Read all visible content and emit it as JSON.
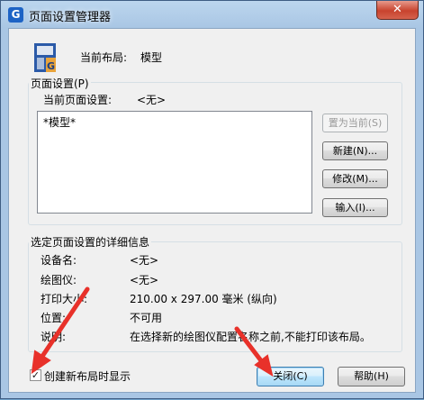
{
  "window": {
    "title": "页面设置管理器",
    "close_glyph": "✕",
    "app_icon_glyph": "G"
  },
  "current_layout": {
    "label": "当前布局:",
    "value": "模型"
  },
  "page_setup": {
    "group_label": "页面设置(P)",
    "current_label": "当前页面设置:",
    "current_value": "<无>",
    "list_items": [
      "*模型*"
    ],
    "buttons": {
      "set_current": "置为当前(S)",
      "new": "新建(N)...",
      "modify": "修改(M)...",
      "import": "输入(I)..."
    }
  },
  "details": {
    "group_label": "选定页面设置的详细信息",
    "rows": [
      {
        "label": "设备名:",
        "value": "<无>"
      },
      {
        "label": "绘图仪:",
        "value": "<无>"
      },
      {
        "label": "打印大小:",
        "value": "210.00 x 297.00 毫米 (纵向)"
      },
      {
        "label": "位置:",
        "value": "不可用"
      },
      {
        "label": "说明:",
        "value": "在选择新的绘图仪配置名称之前,不能打印该布局。"
      }
    ]
  },
  "footer": {
    "checkbox_label": "创建新布局时显示",
    "checkbox_checked": true,
    "checkbox_glyph": "✓",
    "close_button": "关闭(C)",
    "help_button": "帮助(H)"
  },
  "colors": {
    "arrow": "#e8312a",
    "accent": "#1d63c5"
  }
}
